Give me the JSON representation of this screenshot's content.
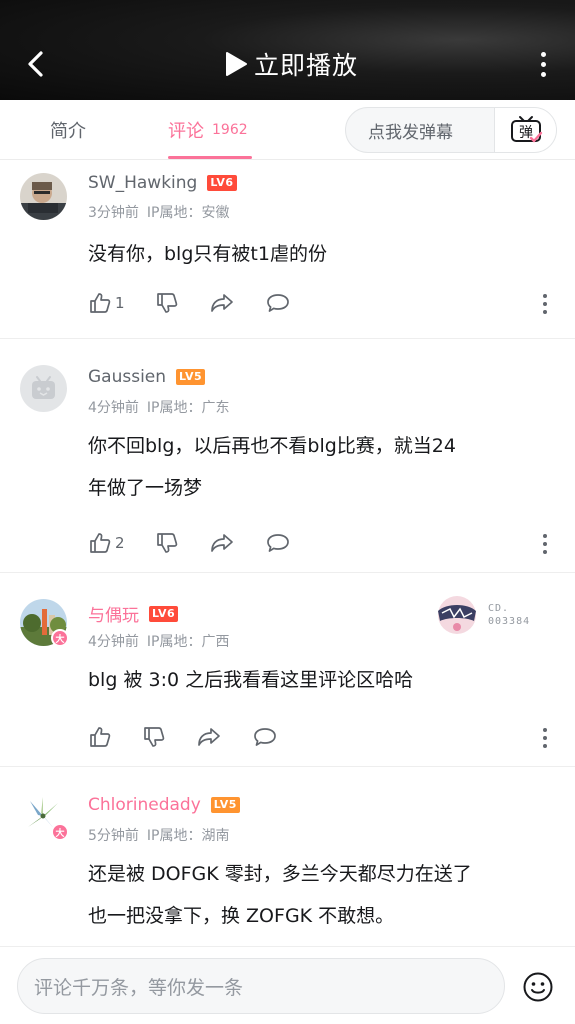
{
  "header": {
    "play_label": "立即播放"
  },
  "tabs": {
    "intro": "简介",
    "comments": "评论",
    "comments_count": "1962"
  },
  "danmaku": {
    "placeholder": "点我发弹幕",
    "button_glyph": "弹"
  },
  "comments": [
    {
      "username": "SW_Hawking",
      "level": "LV6",
      "time": "3分钟前",
      "ip": "IP属地：安徽",
      "text": "没有你，blg只有被t1虐的份",
      "likes": "1"
    },
    {
      "username": "Gaussien",
      "level": "LV5",
      "time": "4分钟前",
      "ip": "IP属地：广东",
      "text_line1": "你不回blg，以后再也不看blg比赛，就当24",
      "text_line2": "年做了一场梦",
      "likes": "2"
    },
    {
      "username": "与偶玩",
      "level": "LV6",
      "time": "4分钟前",
      "ip": "IP属地：广西",
      "text": "blg 被 3:0 之后我看看这里评论区哈哈",
      "fan_badge_line1": "CD.",
      "fan_badge_line2": "003384",
      "avatar_badge": "大"
    },
    {
      "username": "Chlorinedady",
      "level": "LV5",
      "time": "5分钟前",
      "ip": "IP属地：湖南",
      "text_line1": "还是被 DOFGK 零封，多兰今天都尽力在送了",
      "text_line2": "也一把没拿下，换 ZOFGK 不敢想。",
      "avatar_badge": "大"
    }
  ],
  "reply": {
    "placeholder": "评论千万条，等你发一条"
  },
  "colors": {
    "accent": "#fb7299",
    "lv6": "#ff4b3a",
    "lv5": "#ff9430"
  }
}
